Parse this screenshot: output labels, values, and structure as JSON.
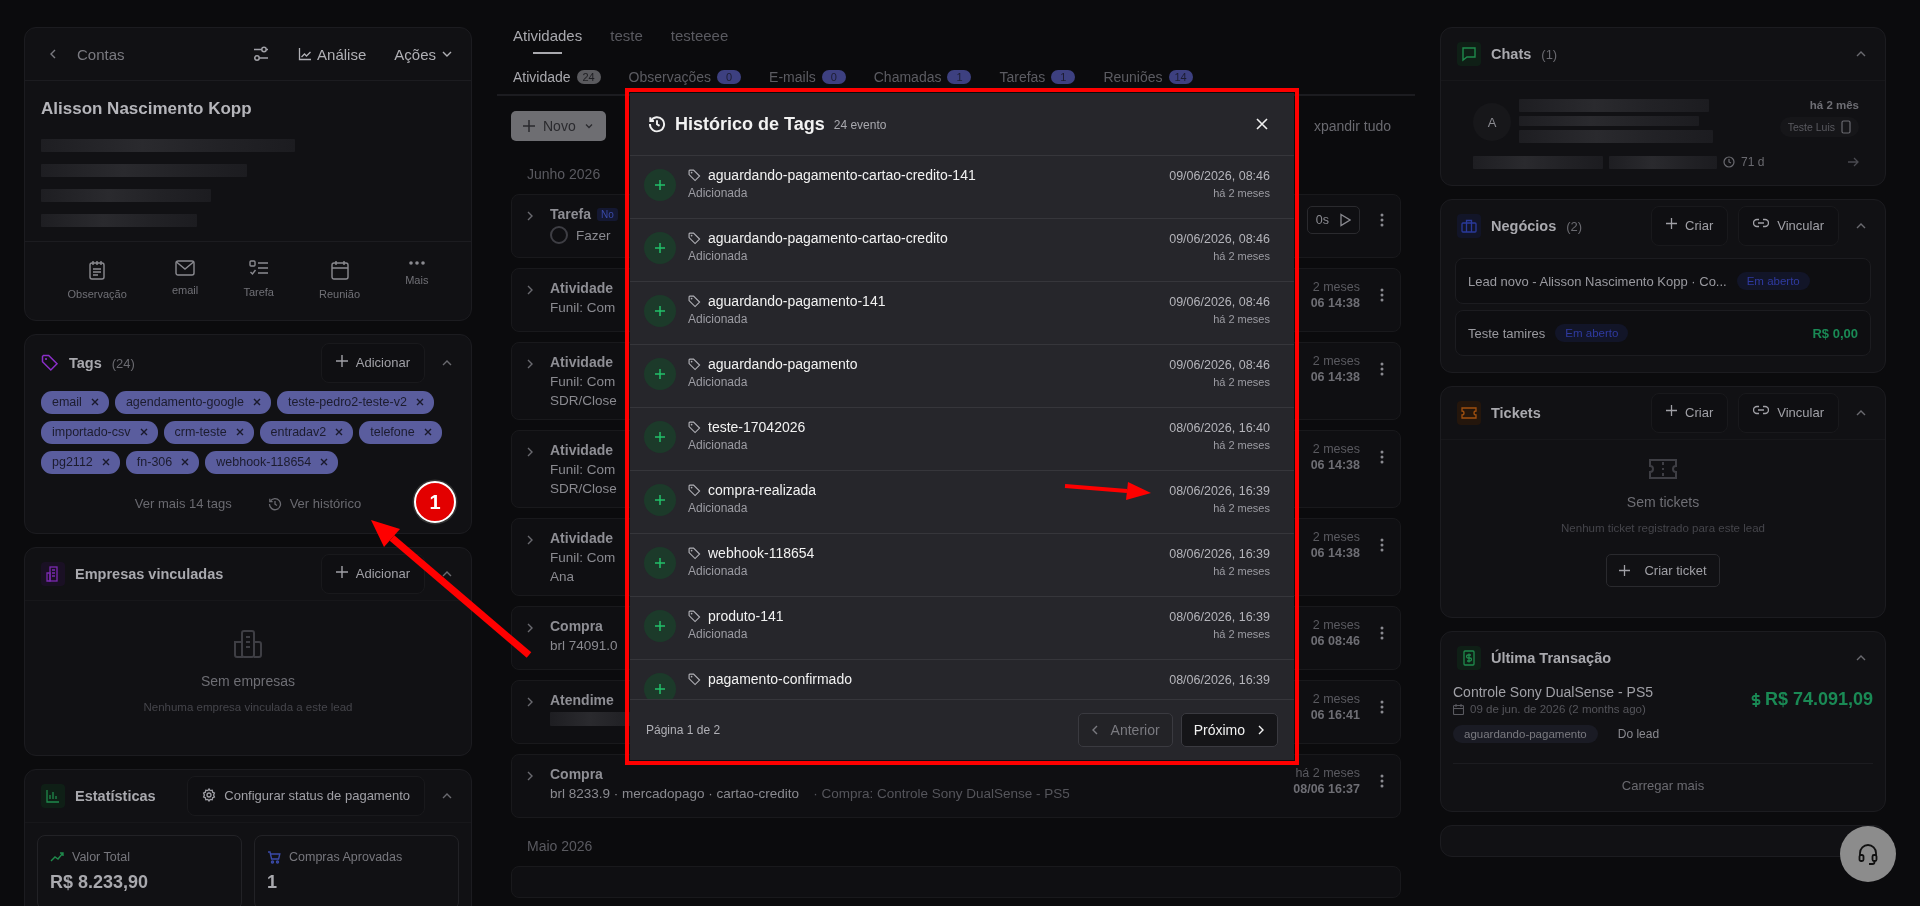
{
  "left": {
    "account": {
      "back_label": "Contas",
      "analysis_label": "Análise",
      "actions_label": "Ações",
      "name": "Alisson Nascimento Kopp",
      "quick_actions": [
        {
          "kind": "note",
          "label": "Observação"
        },
        {
          "kind": "email",
          "label": "email"
        },
        {
          "kind": "task",
          "label": "Tarefa"
        },
        {
          "kind": "meeting",
          "label": "Reunião"
        },
        {
          "kind": "more",
          "label": "Mais"
        }
      ]
    },
    "tags": {
      "title": "Tags",
      "count": "(24)",
      "add_label": "Adicionar",
      "items": [
        "email",
        "agendamento-google",
        "teste-pedro2-teste-v2",
        "importado-csv",
        "crm-teste",
        "entradav2",
        "telefone",
        "pg2112",
        "fn-306",
        "webhook-118654"
      ],
      "more_label": "Ver mais 14 tags",
      "history_label": "Ver histórico"
    },
    "companies": {
      "title": "Empresas vinculadas",
      "add_label": "Adicionar",
      "empty_title": "Sem empresas",
      "empty_text": "Nenhuma empresa vinculada a este lead"
    },
    "stats": {
      "title": "Estatísticas",
      "config_label": "Configurar status de pagamento",
      "cards": [
        {
          "kind": "total",
          "label": "Valor Total",
          "value": "R$ 8.233,90"
        },
        {
          "kind": "purchases",
          "label": "Compras Aprovadas",
          "value": "1"
        }
      ]
    }
  },
  "center": {
    "tabs": [
      {
        "label": "Atividades",
        "selected": true
      },
      {
        "label": "teste",
        "selected": false
      },
      {
        "label": "testeeee",
        "selected": false
      }
    ],
    "filters": [
      {
        "label": "Atividade",
        "count": "24",
        "selected": true
      },
      {
        "label": "Observações",
        "count": "0",
        "selected": false
      },
      {
        "label": "E-mails",
        "count": "0",
        "selected": false
      },
      {
        "label": "Chamadas",
        "count": "1",
        "selected": false
      },
      {
        "label": "Tarefas",
        "count": "1",
        "selected": false
      },
      {
        "label": "Reuniões",
        "count": "14",
        "selected": false
      }
    ],
    "new_label": "Novo",
    "expand_label": "xpandir tudo",
    "month": "Junho 2026",
    "activities": [
      {
        "kind": "task",
        "title": "Tarefa",
        "badge": "No",
        "lines": [
          "Fazer"
        ],
        "checked": false,
        "action": "0s"
      },
      {
        "kind": "activity",
        "title": "Atividade",
        "lines": [
          "Funil: Com"
        ],
        "ago": "2 meses",
        "time": "06 14:38"
      },
      {
        "kind": "activity",
        "title": "Atividade",
        "lines": [
          "Funil: Com",
          "SDR/Close"
        ],
        "ago": "2 meses",
        "time": "06 14:38"
      },
      {
        "kind": "activity",
        "title": "Atividade",
        "lines": [
          "Funil: Com",
          "SDR/Close"
        ],
        "ago": "2 meses",
        "time": "06 14:38"
      },
      {
        "kind": "activity",
        "title": "Atividade",
        "lines": [
          "Funil: Com",
          "Ana"
        ],
        "ago": "2 meses",
        "time": "06 14:38"
      },
      {
        "kind": "activity",
        "title": "Compra",
        "lines": [
          "brl 74091.0"
        ],
        "ago": "2 meses",
        "time": "06 08:46"
      },
      {
        "kind": "activity",
        "title": "Atendime",
        "redacted": true,
        "ago": "2 meses",
        "time": "06 16:41"
      },
      {
        "kind": "activity",
        "title": "Compra",
        "lines": [
          "brl 8233.9 · mercadopago · cartao-credito"
        ],
        "note": "· Compra: Controle Sony DualSense - PS5",
        "ago": "há 2 meses",
        "time": "08/06 16:37"
      }
    ],
    "next_month": "Maio 2026"
  },
  "modal": {
    "title": "Histórico de Tags",
    "count": "24 evento",
    "events": [
      {
        "tag": "aguardando-pagamento-cartao-credito-141",
        "status": "Adicionada",
        "date": "09/06/2026, 08:46",
        "ago": "há 2 meses"
      },
      {
        "tag": "aguardando-pagamento-cartao-credito",
        "status": "Adicionada",
        "date": "09/06/2026, 08:46",
        "ago": "há 2 meses"
      },
      {
        "tag": "aguardando-pagamento-141",
        "status": "Adicionada",
        "date": "09/06/2026, 08:46",
        "ago": "há 2 meses"
      },
      {
        "tag": "aguardando-pagamento",
        "status": "Adicionada",
        "date": "09/06/2026, 08:46",
        "ago": "há 2 meses"
      },
      {
        "tag": "teste-17042026",
        "status": "Adicionada",
        "date": "08/06/2026, 16:40",
        "ago": "há 2 meses"
      },
      {
        "tag": "compra-realizada",
        "status": "Adicionada",
        "date": "08/06/2026, 16:39",
        "ago": "há 2 meses"
      },
      {
        "tag": "webhook-118654",
        "status": "Adicionada",
        "date": "08/06/2026, 16:39",
        "ago": "há 2 meses"
      },
      {
        "tag": "produto-141",
        "status": "Adicionada",
        "date": "08/06/2026, 16:39",
        "ago": "há 2 meses"
      },
      {
        "tag": "pagamento-confirmado",
        "date": "08/06/2026, 16:39"
      }
    ],
    "page_label": "Página 1 de 2",
    "prev_label": "Anterior",
    "next_label": "Próximo",
    "prev_disabled": true
  },
  "right": {
    "chats": {
      "title": "Chats",
      "count": "(1)",
      "avatar": "A",
      "ago": "há 2 mês",
      "agent": "Teste Luis",
      "duration": "71 d"
    },
    "deals": {
      "title": "Negócios",
      "count": "(2)",
      "create_label": "Criar",
      "link_label": "Vincular",
      "items": [
        {
          "name": "Lead novo - Alisson Nascimento Kopp · Co...",
          "status": "Em aberto"
        },
        {
          "name": "Teste tamires",
          "status": "Em aberto",
          "value": "R$ 0,00"
        }
      ]
    },
    "tickets": {
      "title": "Tickets",
      "create_label": "Criar",
      "link_label": "Vincular",
      "empty_title": "Sem tickets",
      "empty_text": "Nenhum ticket registrado para este lead",
      "button_label": "Criar ticket"
    },
    "transaction": {
      "title": "Última Transação",
      "product": "Controle Sony DualSense - PS5",
      "date": "09 de jun. de 2026 (2 months ago)",
      "amount": "R$ 74.091,09",
      "status_tag": "aguardando-pagamento",
      "origin": "Do lead",
      "load_more": "Carregar mais"
    }
  },
  "annotations": {
    "badge": "1"
  }
}
